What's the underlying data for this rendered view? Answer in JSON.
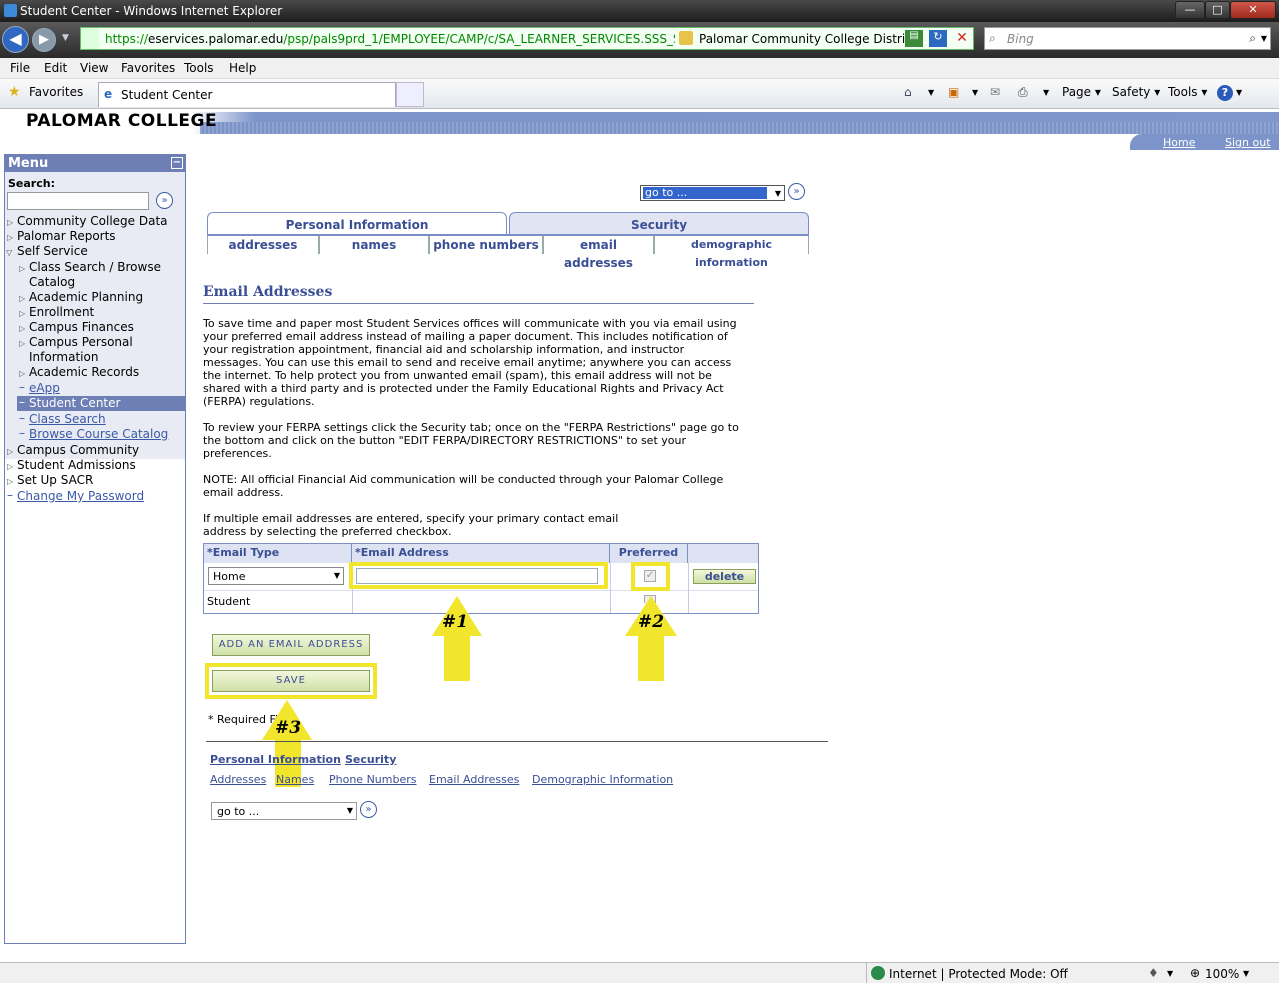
{
  "window": {
    "title": "Student Center - Windows Internet Explorer",
    "minimize": "—",
    "maximize": "□",
    "close": "✕"
  },
  "address_bar": {
    "url_prefix": "https://",
    "url_host": "eservices.palomar.edu",
    "url_path": "/psp/pals9prd_1/EMPLOYEE/CAMP/c/SA_LEARNER_SERVICES.SSS_STUDEN",
    "site_name": "Palomar Community College Distri..."
  },
  "search_bar": {
    "placeholder": "Bing"
  },
  "menubar": [
    "File",
    "Edit",
    "View",
    "Favorites",
    "Tools",
    "Help"
  ],
  "favorites": {
    "label": "Favorites",
    "tab_title": "Student Center"
  },
  "command_bar": {
    "page": "Page ▾",
    "safety": "Safety ▾",
    "tools": "Tools ▾"
  },
  "header": {
    "logo": "PALOMAR COLLEGE",
    "home": "Home",
    "signout": "Sign out"
  },
  "menu": {
    "title": "Menu",
    "search_label": "Search:",
    "items": [
      {
        "label": "Community College Data"
      },
      {
        "label": "Palomar Reports"
      },
      {
        "label": "Self Service"
      },
      {
        "label": "Class Search / Browse"
      },
      {
        "label": "Catalog"
      },
      {
        "label": "Academic Planning"
      },
      {
        "label": "Enrollment"
      },
      {
        "label": "Campus Finances"
      },
      {
        "label": "Campus Personal"
      },
      {
        "label": "Information"
      },
      {
        "label": "Academic Records"
      },
      {
        "label": "eApp"
      },
      {
        "label": "Student Center"
      },
      {
        "label": "Class Search"
      },
      {
        "label": "Browse Course Catalog"
      },
      {
        "label": "Campus Community"
      },
      {
        "label": "Student Admissions"
      },
      {
        "label": "Set Up SACR"
      },
      {
        "label": "Change My Password"
      }
    ]
  },
  "goto": {
    "value": "go to ..."
  },
  "tabs": {
    "primary": [
      "Personal Information",
      "Security"
    ],
    "secondary": [
      "addresses",
      "names",
      "phone numbers",
      "email addresses",
      "demographic information"
    ]
  },
  "content": {
    "heading": "Email Addresses",
    "p1": "To save time and paper most Student Services offices will communicate with you via email using your preferred email address instead of mailing a paper document. This includes notification of your registration appointment, financial aid and scholarship information, and instructor messages. You can use this email to send and receive email anytime; anywhere you can access the internet. To help protect you from unwanted email (spam), this email address will not be shared with a third party and is protected under the Family Educational Rights and Privacy Act (FERPA) regulations.",
    "p2": "To review your FERPA settings click the Security tab; once on the \"FERPA Restrictions\" page go to the bottom and click on the button \"EDIT FERPA/DIRECTORY RESTRICTIONS\" to set your preferences.",
    "p3": "NOTE: All official Financial Aid communication will be conducted through your Palomar College email address.",
    "p4": "If multiple email addresses are entered, specify your primary contact email address by selecting the preferred checkbox."
  },
  "grid": {
    "headers": [
      "*Email Type",
      "*Email Address",
      "Preferred"
    ],
    "rows": [
      {
        "type": "Home",
        "email": "",
        "preferred": true,
        "action": "delete"
      },
      {
        "type": "Student",
        "email": "",
        "preferred": false
      }
    ]
  },
  "buttons": {
    "add": "Add An Email Address",
    "save": "Save"
  },
  "annotations": {
    "a1": "#1",
    "a2": "#2",
    "a3": "#3",
    "color": "#f1e62b"
  },
  "required": "* Required Field",
  "footer_links": {
    "row1": [
      "Personal Information",
      "Security"
    ],
    "row2": [
      "Addresses",
      "Names",
      "Phone Numbers",
      "Email Addresses",
      "Demographic Information"
    ]
  },
  "goto2": {
    "value": "go to ..."
  },
  "statusbar": {
    "zone": "Internet | Protected Mode: Off",
    "zoom": "100%"
  }
}
